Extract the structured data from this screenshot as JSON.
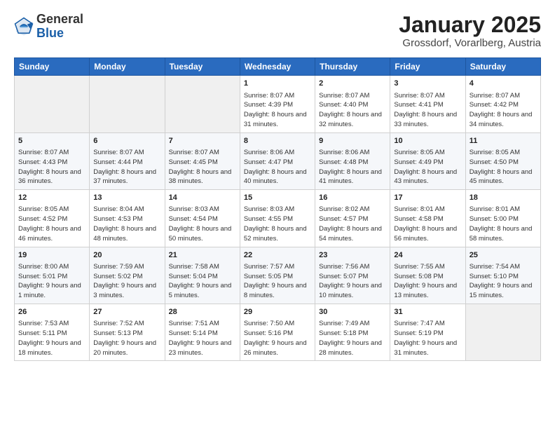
{
  "header": {
    "logo_general": "General",
    "logo_blue": "Blue",
    "title": "January 2025",
    "subtitle": "Grossdorf, Vorarlberg, Austria"
  },
  "weekdays": [
    "Sunday",
    "Monday",
    "Tuesday",
    "Wednesday",
    "Thursday",
    "Friday",
    "Saturday"
  ],
  "weeks": [
    [
      {
        "day": "",
        "info": ""
      },
      {
        "day": "",
        "info": ""
      },
      {
        "day": "",
        "info": ""
      },
      {
        "day": "1",
        "info": "Sunrise: 8:07 AM\nSunset: 4:39 PM\nDaylight: 8 hours and 31 minutes."
      },
      {
        "day": "2",
        "info": "Sunrise: 8:07 AM\nSunset: 4:40 PM\nDaylight: 8 hours and 32 minutes."
      },
      {
        "day": "3",
        "info": "Sunrise: 8:07 AM\nSunset: 4:41 PM\nDaylight: 8 hours and 33 minutes."
      },
      {
        "day": "4",
        "info": "Sunrise: 8:07 AM\nSunset: 4:42 PM\nDaylight: 8 hours and 34 minutes."
      }
    ],
    [
      {
        "day": "5",
        "info": "Sunrise: 8:07 AM\nSunset: 4:43 PM\nDaylight: 8 hours and 36 minutes."
      },
      {
        "day": "6",
        "info": "Sunrise: 8:07 AM\nSunset: 4:44 PM\nDaylight: 8 hours and 37 minutes."
      },
      {
        "day": "7",
        "info": "Sunrise: 8:07 AM\nSunset: 4:45 PM\nDaylight: 8 hours and 38 minutes."
      },
      {
        "day": "8",
        "info": "Sunrise: 8:06 AM\nSunset: 4:47 PM\nDaylight: 8 hours and 40 minutes."
      },
      {
        "day": "9",
        "info": "Sunrise: 8:06 AM\nSunset: 4:48 PM\nDaylight: 8 hours and 41 minutes."
      },
      {
        "day": "10",
        "info": "Sunrise: 8:05 AM\nSunset: 4:49 PM\nDaylight: 8 hours and 43 minutes."
      },
      {
        "day": "11",
        "info": "Sunrise: 8:05 AM\nSunset: 4:50 PM\nDaylight: 8 hours and 45 minutes."
      }
    ],
    [
      {
        "day": "12",
        "info": "Sunrise: 8:05 AM\nSunset: 4:52 PM\nDaylight: 8 hours and 46 minutes."
      },
      {
        "day": "13",
        "info": "Sunrise: 8:04 AM\nSunset: 4:53 PM\nDaylight: 8 hours and 48 minutes."
      },
      {
        "day": "14",
        "info": "Sunrise: 8:03 AM\nSunset: 4:54 PM\nDaylight: 8 hours and 50 minutes."
      },
      {
        "day": "15",
        "info": "Sunrise: 8:03 AM\nSunset: 4:55 PM\nDaylight: 8 hours and 52 minutes."
      },
      {
        "day": "16",
        "info": "Sunrise: 8:02 AM\nSunset: 4:57 PM\nDaylight: 8 hours and 54 minutes."
      },
      {
        "day": "17",
        "info": "Sunrise: 8:01 AM\nSunset: 4:58 PM\nDaylight: 8 hours and 56 minutes."
      },
      {
        "day": "18",
        "info": "Sunrise: 8:01 AM\nSunset: 5:00 PM\nDaylight: 8 hours and 58 minutes."
      }
    ],
    [
      {
        "day": "19",
        "info": "Sunrise: 8:00 AM\nSunset: 5:01 PM\nDaylight: 9 hours and 1 minute."
      },
      {
        "day": "20",
        "info": "Sunrise: 7:59 AM\nSunset: 5:02 PM\nDaylight: 9 hours and 3 minutes."
      },
      {
        "day": "21",
        "info": "Sunrise: 7:58 AM\nSunset: 5:04 PM\nDaylight: 9 hours and 5 minutes."
      },
      {
        "day": "22",
        "info": "Sunrise: 7:57 AM\nSunset: 5:05 PM\nDaylight: 9 hours and 8 minutes."
      },
      {
        "day": "23",
        "info": "Sunrise: 7:56 AM\nSunset: 5:07 PM\nDaylight: 9 hours and 10 minutes."
      },
      {
        "day": "24",
        "info": "Sunrise: 7:55 AM\nSunset: 5:08 PM\nDaylight: 9 hours and 13 minutes."
      },
      {
        "day": "25",
        "info": "Sunrise: 7:54 AM\nSunset: 5:10 PM\nDaylight: 9 hours and 15 minutes."
      }
    ],
    [
      {
        "day": "26",
        "info": "Sunrise: 7:53 AM\nSunset: 5:11 PM\nDaylight: 9 hours and 18 minutes."
      },
      {
        "day": "27",
        "info": "Sunrise: 7:52 AM\nSunset: 5:13 PM\nDaylight: 9 hours and 20 minutes."
      },
      {
        "day": "28",
        "info": "Sunrise: 7:51 AM\nSunset: 5:14 PM\nDaylight: 9 hours and 23 minutes."
      },
      {
        "day": "29",
        "info": "Sunrise: 7:50 AM\nSunset: 5:16 PM\nDaylight: 9 hours and 26 minutes."
      },
      {
        "day": "30",
        "info": "Sunrise: 7:49 AM\nSunset: 5:18 PM\nDaylight: 9 hours and 28 minutes."
      },
      {
        "day": "31",
        "info": "Sunrise: 7:47 AM\nSunset: 5:19 PM\nDaylight: 9 hours and 31 minutes."
      },
      {
        "day": "",
        "info": ""
      }
    ]
  ]
}
